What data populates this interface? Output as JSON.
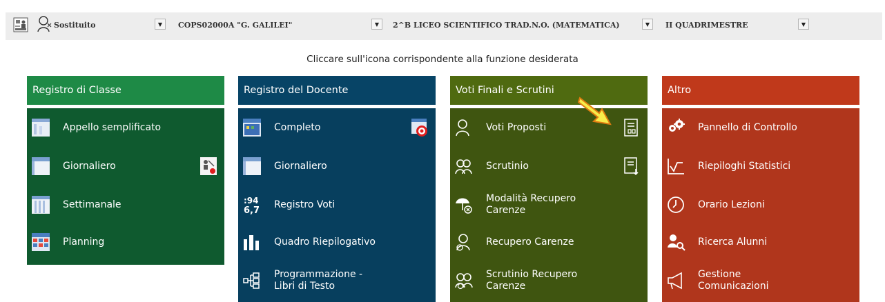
{
  "topbar": {
    "user_label": "Sostituito",
    "school": "COPS02000A \"G. GALILEI\"",
    "class": "2^B LICEO SCIENTIFICO TRAD.N.O. (MATEMATICA)",
    "period": "II QUADRIMESTRE",
    "dropdown_arrow": "▼"
  },
  "instruction": "Cliccare sull'icona corrispondente alla funzione desiderata",
  "panels": [
    {
      "title": "Registro di Classe",
      "header_color": "#1e8a46",
      "body_color": "#0f5a2f",
      "items": [
        "Appello semplificato",
        "Giornaliero",
        "Settimanale",
        "Planning"
      ]
    },
    {
      "title": "Registro del Docente",
      "header_color": "#074466",
      "body_color": "#073f5e",
      "items": [
        "Completo",
        "Giornaliero",
        "Registro Voti",
        "Quadro Riepilogativo",
        "Programmazione - Libri di Testo"
      ]
    },
    {
      "title": "Voti Finali e Scrutini",
      "header_color": "#4f6a10",
      "body_color": "#3f5510",
      "items": [
        "Voti Proposti",
        "Scrutinio",
        "Modalità Recupero Carenze",
        "Recupero Carenze",
        "Scrutinio Recupero Carenze"
      ]
    },
    {
      "title": "Altro",
      "header_color": "#c0391b",
      "body_color": "#b0361c",
      "items": [
        "Pannello di Controllo",
        "Riepiloghi Statistici",
        "Orario Lezioni",
        "Ricerca Alunni",
        "Gestione Comunicazioni"
      ]
    }
  ],
  "icons": {
    "top_left": "school-icon",
    "user": "user-icon",
    "arrow": "pointer-arrow-icon"
  }
}
